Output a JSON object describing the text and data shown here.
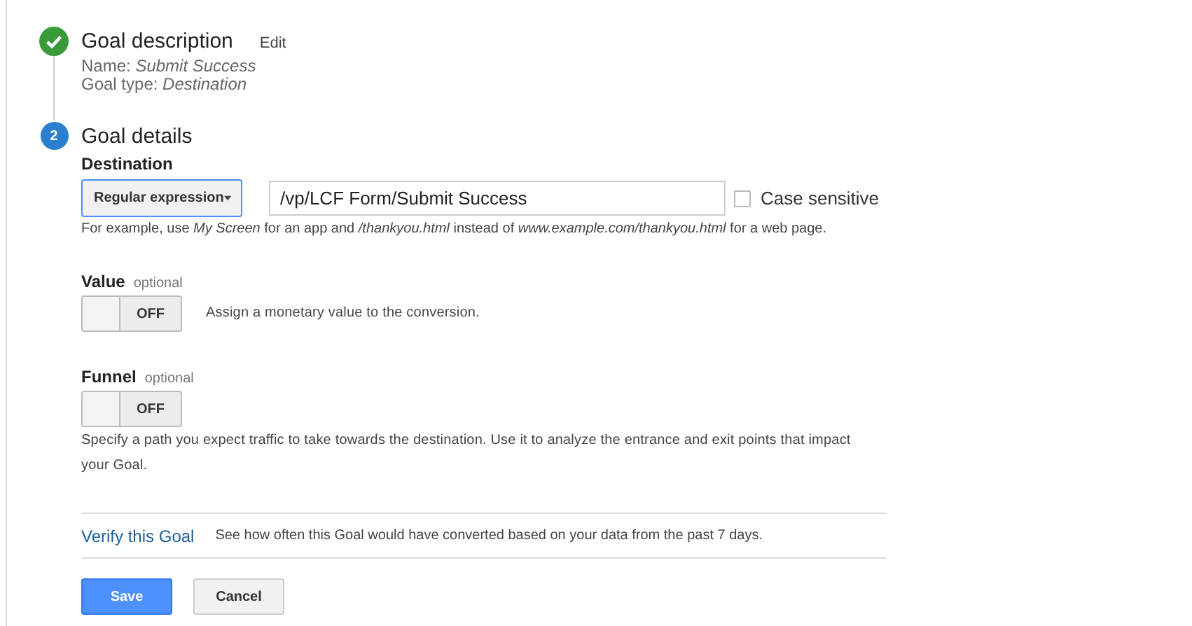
{
  "step_one": {
    "kind": "done",
    "title": "Goal description",
    "edit_link": "Edit",
    "name_label": "Name:",
    "name_value": "Submit Success",
    "type_label": "Goal type:",
    "type_value": "Destination"
  },
  "step_two": {
    "kind": "numbered",
    "number": "2",
    "title": "Goal details"
  },
  "destination": {
    "label": "Destination",
    "match_type": "Regular expression",
    "value": "/vp/LCF Form/Submit Success",
    "case_sensitive": {
      "label": "Case sensitive",
      "checked": false
    },
    "hint": "For example, use *My Screen* for an app and */thankyou.html* instead of *www.example.com/thankyou.html* for a web page."
  },
  "value": {
    "label": "Value",
    "optional": "optional",
    "toggle": {
      "on": false,
      "text": "OFF"
    },
    "description": "Assign a monetary value to the conversion."
  },
  "funnel": {
    "label": "Funnel",
    "optional": "optional",
    "toggle": {
      "on": false,
      "text": "OFF"
    },
    "description": "Specify a path you expect traffic to take towards the destination. Use it to analyze the entrance and exit points that impact your Goal."
  },
  "verify": {
    "link": "Verify this Goal",
    "description": "See how often this Goal would have converted based on your data from the past 7 days."
  },
  "buttons": {
    "save": "Save",
    "cancel": "Cancel"
  }
}
